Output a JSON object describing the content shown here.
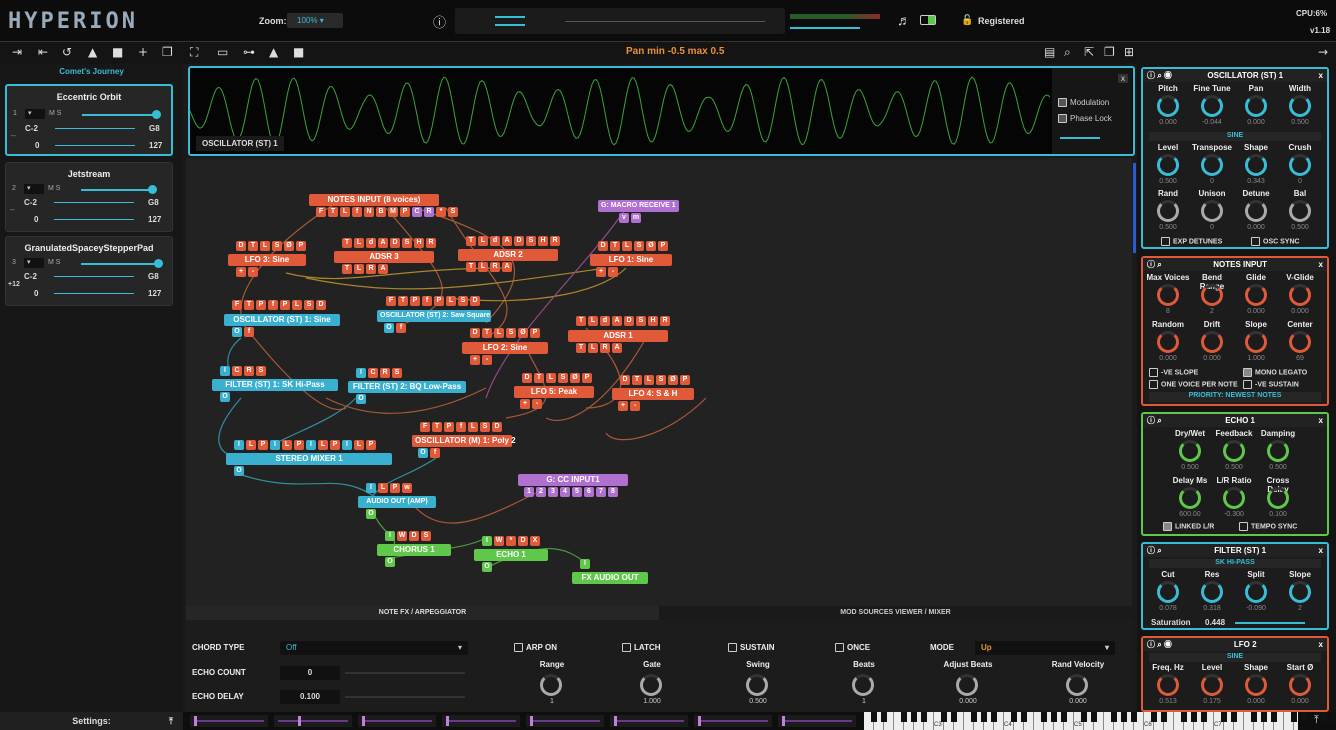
{
  "app": {
    "title": "HYPERION",
    "zoom_label": "Zoom:",
    "zoom_value": "100%",
    "status": "Registered",
    "cpu": "CPU:6%",
    "version": "v1.18"
  },
  "toolbar": {
    "center_text": "Pan  min -0.5 max 0.5"
  },
  "left": {
    "bank_name": "Comet's Journey",
    "presets": [
      {
        "name": "Eccentric Orbit",
        "idx": "1",
        "low": "C-2",
        "high": "G8",
        "vlow": "0",
        "vhigh": "127",
        "ms": "M  S",
        "transpose": "--"
      },
      {
        "name": "Jetstream",
        "idx": "2",
        "low": "C-2",
        "high": "G8",
        "vlow": "0",
        "vhigh": "127",
        "ms": "M  S",
        "transpose": "--"
      },
      {
        "name": "GranulatedSpaceyStepperPad",
        "idx": "3",
        "low": "C-2",
        "high": "G8",
        "vlow": "0",
        "vhigh": "127",
        "ms": "M  S",
        "transpose": "+12"
      }
    ]
  },
  "wave": {
    "label": "OSCILLATOR (ST) 1",
    "modulation": "Modulation",
    "phase_lock": "Phase Lock",
    "close": "x"
  },
  "nodes": {
    "notes_input": "NOTES INPUT  (8 voices)",
    "notes_pins": "F T L f N B M P C R * S",
    "macro": "G: MACRO RECEIVE 1",
    "macro_pins": "v m",
    "lfo3": "LFO 3: Sine",
    "adsr3": "ADSR 3",
    "adsr2": "ADSR 2",
    "lfo1": "LFO 1: Sine",
    "osc1": "OSCILLATOR (ST) 1: Sine",
    "osc2": "OSCILLATOR (ST) 2: Saw Square",
    "lfo2": "LFO 2: Sine",
    "adsr1": "ADSR 1",
    "filter1": "FILTER (ST) 1: SK Hi-Pass",
    "filter2": "FILTER (ST) 2: BQ Low-Pass",
    "lfo5": "LFO 5: Peak",
    "lfo4": "LFO 4: S & H",
    "mixer": "STEREO MIXER 1",
    "oscm": "OSCILLATOR (M) 1: Poly 2",
    "cc": "G: CC INPUT1",
    "cc_pins": "1 2 3 4 5 6 7 8",
    "audio_out": "AUDIO OUT (AMP)",
    "chorus": "CHORUS 1",
    "echo": "ECHO 1",
    "fx_out": "FX AUDIO OUT"
  },
  "right": {
    "osc": {
      "title": "OSCILLATOR (ST) 1",
      "k1": [
        "Pitch",
        "Fine Tune",
        "Pan",
        "Width"
      ],
      "v1": [
        "0.000",
        "-0.044",
        "0.000",
        "0.500"
      ],
      "wave": "SINE",
      "k2": [
        "Level",
        "Transpose",
        "Shape",
        "Crush"
      ],
      "v2": [
        "0.500",
        "0",
        "0.343",
        "0"
      ],
      "k3": [
        "Rand",
        "Unison",
        "Detune",
        "Bal"
      ],
      "v3": [
        "0.500",
        "0",
        "0.000",
        "0.500"
      ],
      "c1": "EXP DETUNES",
      "c2": "OSC SYNC"
    },
    "notes": {
      "title": "NOTES INPUT",
      "k1": [
        "Max Voices",
        "Bend Range",
        "Glide",
        "V-Glide"
      ],
      "v1": [
        "8",
        "2",
        "0.000",
        "0.000"
      ],
      "k2": [
        "Random",
        "Drift",
        "Slope",
        "Center"
      ],
      "v2": [
        "0.000",
        "0.000",
        "1.000",
        "69"
      ],
      "c1": "-VE SLOPE",
      "c2": "MONO LEGATO",
      "c3": "ONE VOICE PER NOTE",
      "c4": "-VE SUSTAIN",
      "priority": "PRIORITY: NEWEST NOTES"
    },
    "echo": {
      "title": "ECHO 1",
      "k1": [
        "Dry/Wet",
        "Feedback",
        "Damping"
      ],
      "v1": [
        "0.500",
        "0.500",
        "0.500"
      ],
      "k2": [
        "Delay Ms",
        "L/R Ratio",
        "Cross Delay"
      ],
      "v2": [
        "600.00",
        "-0.300",
        "0.100"
      ],
      "c1": "LINKED L/R",
      "c2": "TEMPO SYNC"
    },
    "filter": {
      "title": "FILTER (ST) 1",
      "type": "SK HI-PASS",
      "k1": [
        "Cut",
        "Res",
        "Split",
        "Slope"
      ],
      "v1": [
        "0.078",
        "0.318",
        "-0.090",
        "2"
      ],
      "sat_label": "Saturation",
      "sat_value": "0.448"
    },
    "lfo2": {
      "title": "LFO 2",
      "wave": "SINE",
      "k1": [
        "Freq. Hz",
        "Level",
        "Shape",
        "Start Ø"
      ],
      "v1": [
        "0.513",
        "0.175",
        "0.000",
        "0.000"
      ]
    }
  },
  "bottom": {
    "tab1": "NOTE FX / ARPEGGIATOR",
    "tab2": "MOD SOURCES VIEWER / MIXER",
    "chord_label": "CHORD TYPE",
    "chord_value": "Off",
    "echo_count_label": "ECHO COUNT",
    "echo_count": "0",
    "echo_delay_label": "ECHO DELAY",
    "echo_delay": "0.100",
    "checks": [
      "ARP ON",
      "LATCH",
      "SUSTAIN",
      "ONCE"
    ],
    "mode_label": "MODE",
    "mode_value": "Up",
    "knobs": [
      "Range",
      "Gate",
      "Swing",
      "Beats",
      "Adjust Beats",
      "Rand Velocity"
    ],
    "kvals": [
      "1",
      "1.000",
      "0.500",
      "1",
      "0.000",
      "0.000"
    ]
  },
  "footer": {
    "settings": "Settings:",
    "keys": [
      "C3",
      "C4",
      "C5",
      "C6",
      "C7"
    ]
  }
}
